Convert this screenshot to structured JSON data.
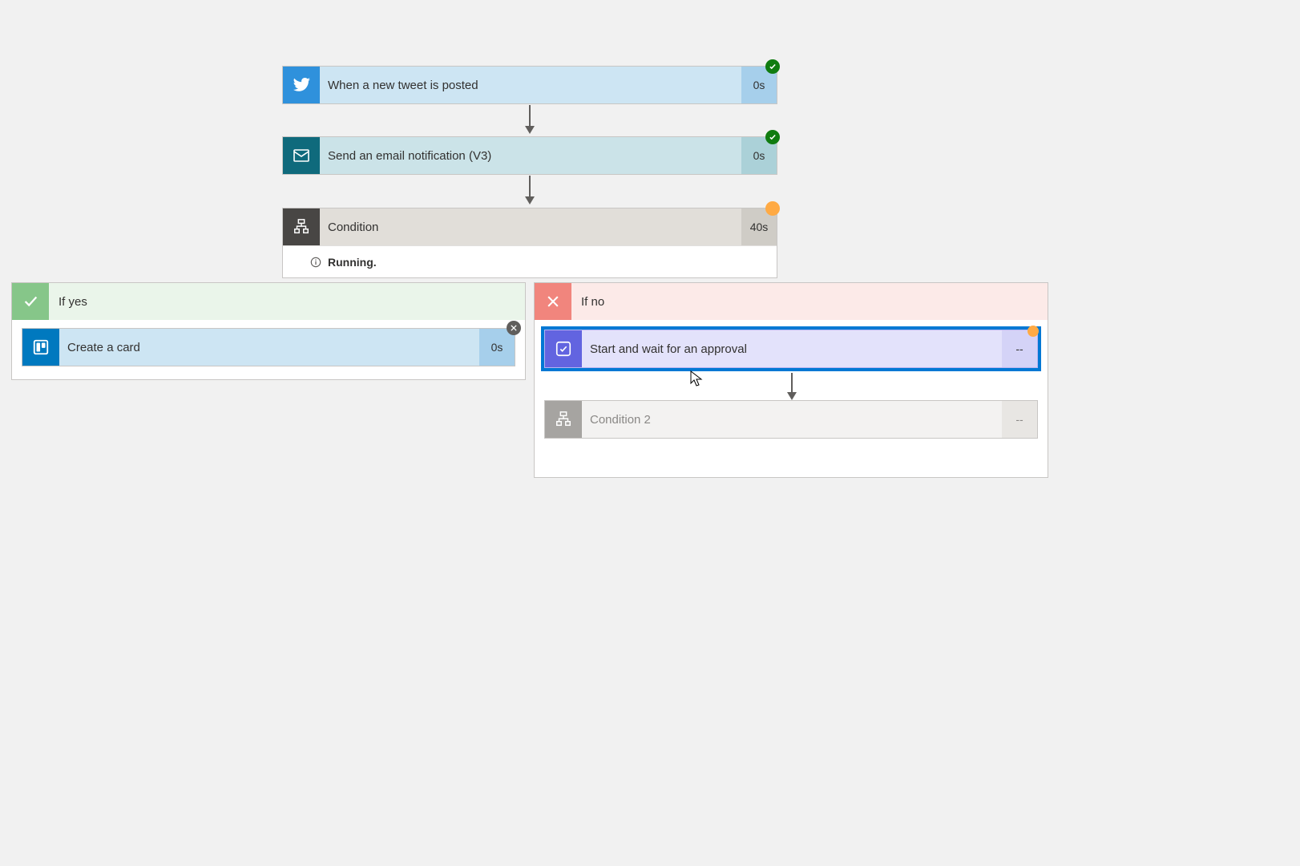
{
  "steps": {
    "tweet": {
      "label": "When a new tweet is posted",
      "time": "0s"
    },
    "email": {
      "label": "Send an email notification (V3)",
      "time": "0s"
    },
    "condition": {
      "label": "Condition",
      "time": "40s",
      "status": "Running."
    }
  },
  "branches": {
    "yes": {
      "title": "If yes",
      "trello": {
        "label": "Create a card",
        "time": "0s"
      }
    },
    "no": {
      "title": "If no",
      "approval": {
        "label": "Start and wait for an approval",
        "time": "--"
      },
      "condition2": {
        "label": "Condition 2",
        "time": "--"
      }
    }
  }
}
